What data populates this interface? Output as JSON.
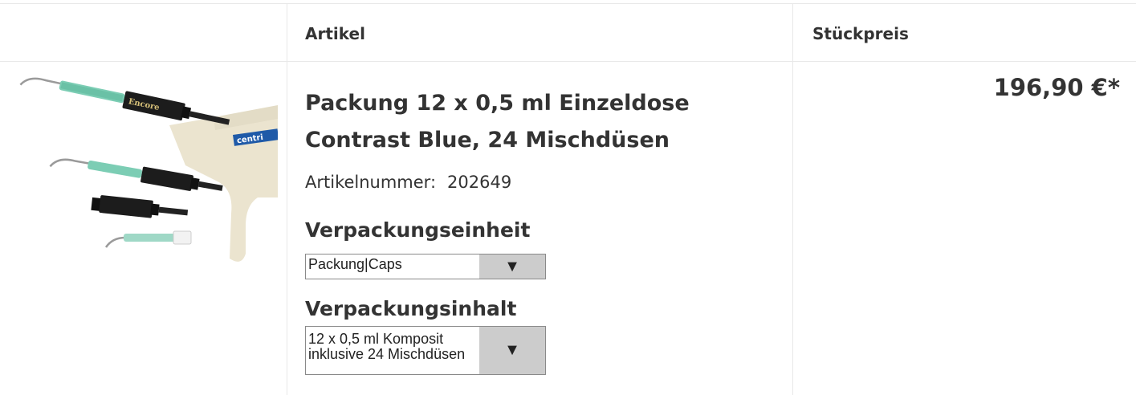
{
  "table": {
    "header_article": "Artikel",
    "header_unit_price": "Stückpreis"
  },
  "product": {
    "title_line1": "Packung 12 x 0,5 ml Einzeldose",
    "title_line2": "Contrast Blue, 24 Mischdüsen",
    "article_number_label": "Artikelnummer:",
    "article_number": "202649",
    "packaging_unit_label": "Verpackungseinheit",
    "packaging_unit_value": "Packung|Caps",
    "packaging_content_label": "Verpackungsinhalt",
    "packaging_content_line1": "12 x 0,5 ml Komposit",
    "packaging_content_line2": "inklusive 24 Mischdüsen",
    "price": "196,90 €*",
    "image_logo_text": "centri",
    "image_syringe_text": "Encore"
  },
  "colors": {
    "grid": "#e8e8e8",
    "select_arrow_bg": "#cccccc",
    "text": "#333333"
  },
  "icons": {
    "dropdown": "triangle-down-icon"
  }
}
